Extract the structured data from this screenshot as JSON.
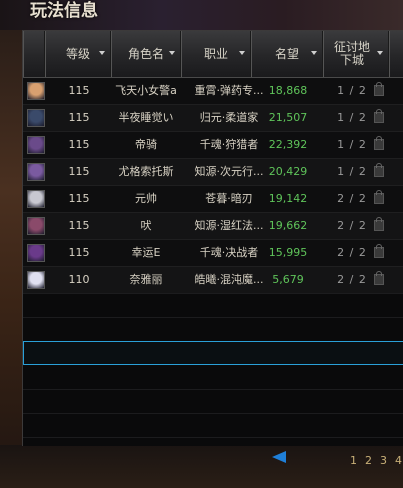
{
  "window": {
    "title": "玩法信息"
  },
  "table": {
    "columns": [
      {
        "label": "等级",
        "sortable": true
      },
      {
        "label": "角色名",
        "sortable": true
      },
      {
        "label": "职业",
        "sortable": true
      },
      {
        "label": "名望",
        "sortable": true
      },
      {
        "label": "征讨地下城",
        "sortable": true
      }
    ],
    "rows": [
      {
        "level": "115",
        "name": "飞天小女警a",
        "job": "重霄·弹药专...",
        "fame": "18,868",
        "dungeon": "1 / 2",
        "avatar_color": "#d8a070"
      },
      {
        "level": "115",
        "name": "半夜睡觉い",
        "job": "归元·柔道家",
        "fame": "21,507",
        "dungeon": "1 / 2",
        "avatar_color": "#3a4a6a"
      },
      {
        "level": "115",
        "name": "帝骑",
        "job": "千魂·狩猎者",
        "fame": "22,392",
        "dungeon": "1 / 2",
        "avatar_color": "#6a4a8a"
      },
      {
        "level": "115",
        "name": "尤格索托斯",
        "job": "知源·次元行...",
        "fame": "20,429",
        "dungeon": "1 / 2",
        "avatar_color": "#7a5aa0"
      },
      {
        "level": "115",
        "name": "元帅",
        "job": "苍暮·暗刃",
        "fame": "19,142",
        "dungeon": "2 / 2",
        "avatar_color": "#c8c8d0"
      },
      {
        "level": "115",
        "name": "吠",
        "job": "知源·湿红法...",
        "fame": "19,662",
        "dungeon": "2 / 2",
        "avatar_color": "#8a4a6a"
      },
      {
        "level": "115",
        "name": "幸运E",
        "job": "千魂·决战者",
        "fame": "15,995",
        "dungeon": "2 / 2",
        "avatar_color": "#6a3a8a"
      },
      {
        "level": "110",
        "name": "奈雅丽",
        "job": "皓曦·混沌魔...",
        "fame": "5,679",
        "dungeon": "2 / 2",
        "avatar_color": "#e0e0f0"
      }
    ]
  },
  "pager": {
    "pages": [
      "1",
      "2",
      "3",
      "4"
    ]
  },
  "colors": {
    "fame": "#5fc45a",
    "selection": "#2aa0d8",
    "pager_arrow": "#1f7fd8",
    "page_numbers": "#c8b078"
  }
}
